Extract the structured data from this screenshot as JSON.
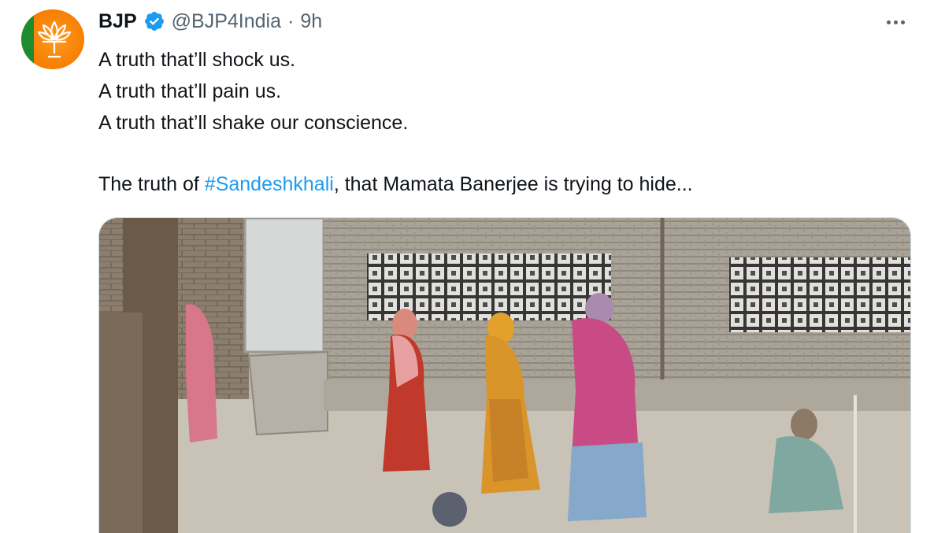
{
  "tweet": {
    "author_name": "BJP",
    "handle": "@BJP4India",
    "separator": "·",
    "time": "9h",
    "lines": [
      "A truth that’ll shock us.",
      "A truth that’ll pain us.",
      "A truth that’ll shake our conscience."
    ],
    "final_prefix": "The truth of ",
    "hashtag": "#Sandeshkhali",
    "final_suffix": ", that Mamata Banerjee is trying to hide..."
  },
  "icons": {
    "verified": "verified-badge-icon",
    "more": "more-options-icon",
    "avatar": "bjp-lotus-logo"
  },
  "colors": {
    "accent": "#1d9bf0",
    "text": "#0f1419",
    "secondary_text": "#536471",
    "avatar_bg": "#f57c00"
  }
}
